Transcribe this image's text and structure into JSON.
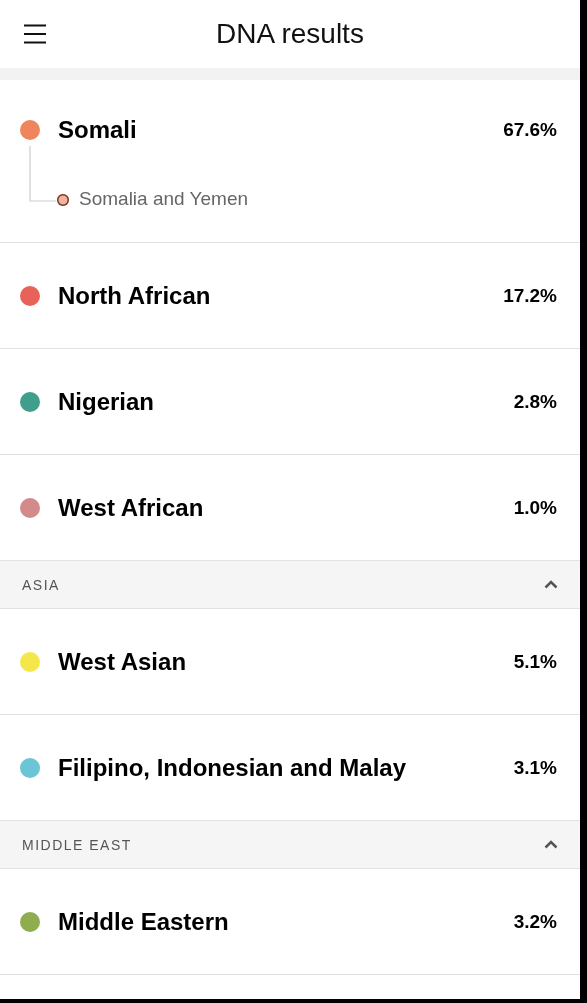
{
  "header": {
    "title": "DNA results"
  },
  "groups": [
    {
      "items": [
        {
          "name": "Somali",
          "percent": "67.6%",
          "color": "#f0845c",
          "children": [
            {
              "name": "Somalia and Yemen",
              "color": "#f2b39a"
            }
          ]
        },
        {
          "name": "North African",
          "percent": "17.2%",
          "color": "#e8625a"
        },
        {
          "name": "Nigerian",
          "percent": "2.8%",
          "color": "#3f9e8c"
        },
        {
          "name": "West African",
          "percent": "1.0%",
          "color": "#d48a8a"
        }
      ]
    },
    {
      "title": "ASIA",
      "expanded": true,
      "items": [
        {
          "name": "West Asian",
          "percent": "5.1%",
          "color": "#f5e64a"
        },
        {
          "name": "Filipino, Indonesian and Malay",
          "percent": "3.1%",
          "color": "#6cc5d6"
        }
      ]
    },
    {
      "title": "MIDDLE EAST",
      "expanded": true,
      "items": [
        {
          "name": "Middle Eastern",
          "percent": "3.2%",
          "color": "#8fad4e"
        }
      ]
    }
  ]
}
